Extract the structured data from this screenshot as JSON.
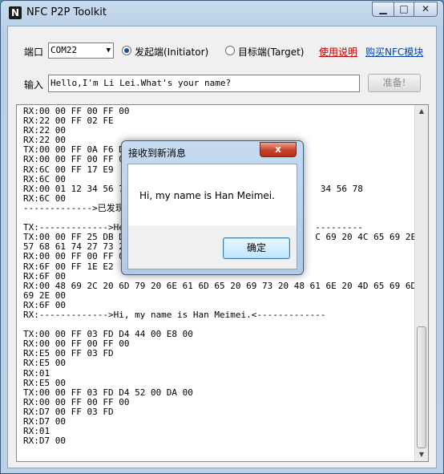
{
  "window": {
    "title": "NFC P2P Toolkit",
    "app_icon": "N"
  },
  "toolbar": {
    "port_label": "端口",
    "port_value": "COM22",
    "radio_initiator": "发起端(Initiator)",
    "radio_target": "目标端(Target)",
    "link_help": "使用说明",
    "link_buy": "购买NFC模块",
    "input_label": "输入",
    "input_value": "Hello,I'm Li Lei.What's your name?",
    "prepare_button": "准备!"
  },
  "log": {
    "lines": [
      "RX:00 00 FF 00 FF 00",
      "RX:22 00 FF 02 FE",
      "RX:22 00",
      "RX:22 00",
      "TX:00 00 FF 0A F6 D4",
      "RX:00 00 FF 00 FF 00",
      "RX:6C 00 FF 17 E9",
      "RX:6C 00",
      "RX:00 01 12 34 56 78                                    34 56 78",
      "RX:6C 00",
      "------------->已发现目",
      "",
      "TX:------------->Hell                                  ---------",
      "TX:00 00 FF 25 DB D4                                   C 69 20 4C 65 69 2E",
      "57 68 61 74 27 73 20",
      "RX:00 00 FF 00 FF 00",
      "RX:6F 00 FF 1E E2",
      "RX:6F 00",
      "RX:00 48 69 2C 20 6D 79 20 6E 61 6D 65 20 69 73 20 48 61 6E 20 4D 65 69 6D 65",
      "69 2E 00",
      "RX:6F 00",
      "RX:------------->Hi, my name is Han Meimei.<-------------",
      "",
      "TX:00 00 FF 03 FD D4 44 00 E8 00",
      "RX:00 00 FF 00 FF 00",
      "RX:E5 00 FF 03 FD",
      "RX:E5 00",
      "RX:01",
      "RX:E5 00",
      "TX:00 00 FF 03 FD D4 52 00 DA 00",
      "RX:00 00 FF 00 FF 00",
      "RX:D7 00 FF 03 FD",
      "RX:D7 00",
      "RX:01",
      "RX:D7 00"
    ]
  },
  "dialog": {
    "title": "接收到新消息",
    "message": "Hi, my name is Han Meimei.",
    "ok_button": "确定",
    "close_glyph": "x"
  },
  "colors": {
    "link_help": "#c00000",
    "link_buy": "#0645ad",
    "dialog_close": "#c9412a"
  }
}
